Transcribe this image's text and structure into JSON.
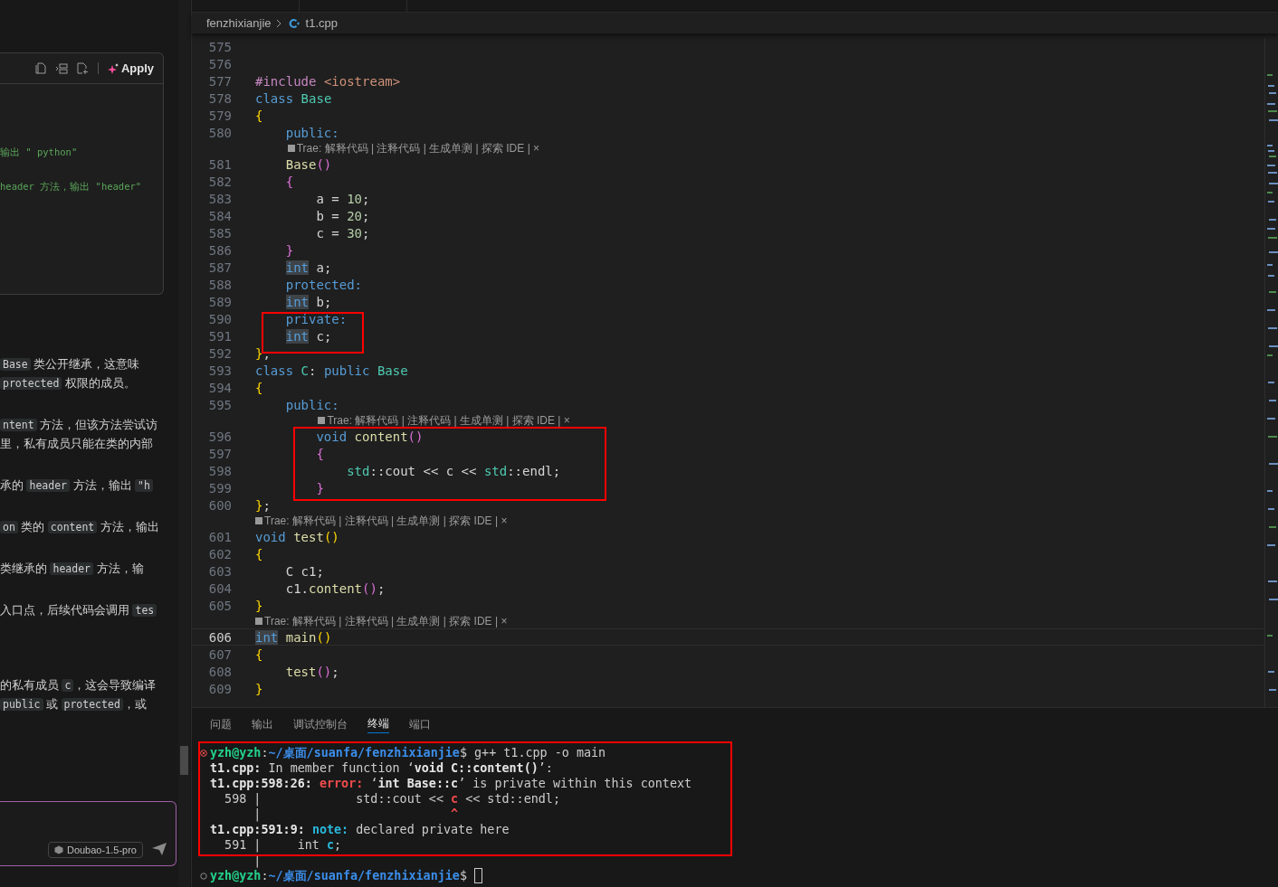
{
  "chat": {
    "code_card": {
      "action": "Apply",
      "lines": [
        "输出 \" python\"",
        "header 方法，输出 \"header\""
      ]
    },
    "sections": [
      [
        [
          [
            {
              "text": "Base",
              "kind": "code"
            },
            {
              "text": " 类公开继承，这意味",
              "kind": "prose"
            }
          ],
          [
            {
              "text": "protected",
              "kind": "code"
            },
            {
              "text": " 权限的成员。",
              "kind": "prose"
            }
          ]
        ],
        [
          [
            {
              "text": "ntent",
              "kind": "code"
            },
            {
              "text": " 方法，但该方法尝试访",
              "kind": "prose"
            }
          ],
          [
            {
              "text": " 里，私有成员只能在类的内部",
              "kind": "prose"
            }
          ]
        ],
        [
          [
            {
              "text": "承的 ",
              "kind": "prose"
            },
            {
              "text": "header",
              "kind": "code"
            },
            {
              "text": " 方法，输出 ",
              "kind": "prose"
            },
            {
              "text": "\"h",
              "kind": "code"
            }
          ]
        ],
        [
          [
            {
              "text": "on",
              "kind": "code"
            },
            {
              "text": " 类的 ",
              "kind": "prose"
            },
            {
              "text": "content",
              "kind": "code"
            },
            {
              "text": " 方法，输出",
              "kind": "prose"
            }
          ]
        ],
        [
          [
            {
              "text": " 类继承的 ",
              "kind": "prose"
            },
            {
              "text": "header",
              "kind": "code"
            },
            {
              "text": " 方法，输",
              "kind": "prose"
            }
          ]
        ],
        [
          [
            {
              "text": "入口点，后续代码会调用 ",
              "kind": "prose"
            },
            {
              "text": "tes",
              "kind": "code"
            }
          ]
        ]
      ],
      [
        [
          [
            {
              "text": "的私有成员 ",
              "kind": "prose"
            },
            {
              "text": "c",
              "kind": "code"
            },
            {
              "text": "，这会导致编译",
              "kind": "prose"
            }
          ],
          [
            {
              "text": "public",
              "kind": "code"
            },
            {
              "text": " 或 ",
              "kind": "prose"
            },
            {
              "text": "protected",
              "kind": "code"
            },
            {
              "text": "，或",
              "kind": "prose"
            }
          ]
        ]
      ]
    ],
    "input": {
      "model": "Doubao-1.5-pro"
    }
  },
  "editor": {
    "breadcrumb": [
      "fenzhixianjie",
      "t1.cpp"
    ],
    "lines": [
      {
        "n": "575",
        "current": false
      },
      {
        "n": "576",
        "current": false
      },
      {
        "n": "577",
        "current": false,
        "tokens": [
          {
            "text": "#include",
            "kind": "pre"
          },
          {
            "text": " <iostream>",
            "kind": "str"
          }
        ]
      },
      {
        "n": "578",
        "current": false,
        "tokens": [
          {
            "text": "class",
            "kind": "kw"
          },
          {
            "text": " Base",
            "kind": "type"
          }
        ]
      },
      {
        "n": "579",
        "current": false,
        "tokens": [
          {
            "text": "{",
            "kind": "b1"
          }
        ]
      },
      {
        "n": "580",
        "current": false,
        "tokens": [
          {
            "text": "    public:",
            "kind": "kw"
          }
        ]
      },
      {
        "n": "581",
        "current": false,
        "lens": "Trae: 解释代码 | 注释代码 | 生成单测 | 探索 IDE | ×",
        "tokens": [
          {
            "text": "    Base",
            "kind": "fn"
          },
          {
            "text": "()",
            "kind": "b2"
          }
        ]
      },
      {
        "n": "582",
        "current": false,
        "tokens": [
          {
            "text": "    {",
            "kind": "b2"
          }
        ]
      },
      {
        "n": "583",
        "current": false,
        "tokens": [
          {
            "text": "        a = ",
            "kind": "plain"
          },
          {
            "text": "10",
            "kind": "num"
          },
          {
            "text": ";",
            "kind": "plain"
          }
        ]
      },
      {
        "n": "584",
        "current": false,
        "tokens": [
          {
            "text": "        b = ",
            "kind": "plain"
          },
          {
            "text": "20",
            "kind": "num"
          },
          {
            "text": ";",
            "kind": "plain"
          }
        ]
      },
      {
        "n": "585",
        "current": false,
        "tokens": [
          {
            "text": "        c = ",
            "kind": "plain"
          },
          {
            "text": "30",
            "kind": "num"
          },
          {
            "text": ";",
            "kind": "plain"
          }
        ]
      },
      {
        "n": "586",
        "current": false,
        "tokens": [
          {
            "text": "    }",
            "kind": "b2"
          }
        ]
      },
      {
        "n": "587",
        "current": false,
        "tokens": [
          {
            "text": "    int",
            "kind": "match"
          },
          {
            "text": " a;",
            "kind": "plain"
          }
        ]
      },
      {
        "n": "588",
        "current": false,
        "tokens": [
          {
            "text": "    protected:",
            "kind": "kw"
          }
        ]
      },
      {
        "n": "589",
        "current": false,
        "tokens": [
          {
            "text": "    int",
            "kind": "match"
          },
          {
            "text": " b;",
            "kind": "plain"
          }
        ]
      },
      {
        "n": "590",
        "current": false,
        "tokens": [
          {
            "text": "    private:",
            "kind": "kw"
          }
        ]
      },
      {
        "n": "591",
        "current": false,
        "tokens": [
          {
            "text": "    int",
            "kind": "match"
          },
          {
            "text": " c;",
            "kind": "plain"
          }
        ]
      },
      {
        "n": "592",
        "current": false,
        "tokens": [
          {
            "text": "}",
            "kind": "b1"
          },
          {
            "text": ";",
            "kind": "plain"
          }
        ]
      },
      {
        "n": "593",
        "current": false,
        "tokens": [
          {
            "text": "class",
            "kind": "kw"
          },
          {
            "text": " C",
            "kind": "type"
          },
          {
            "text": ": ",
            "kind": "plain"
          },
          {
            "text": "public",
            "kind": "kw"
          },
          {
            "text": " Base",
            "kind": "type"
          }
        ]
      },
      {
        "n": "594",
        "current": false,
        "tokens": [
          {
            "text": "{",
            "kind": "b1"
          }
        ]
      },
      {
        "n": "595",
        "current": false,
        "tokens": [
          {
            "text": "    public:",
            "kind": "kw"
          }
        ]
      },
      {
        "n": "596",
        "current": false,
        "lens": "Trae: 解释代码 | 注释代码 | 生成单测 | 探索 IDE | ×",
        "tokens": [
          {
            "text": "        void",
            "kind": "kw"
          },
          {
            "text": " content",
            "kind": "fn"
          },
          {
            "text": "()",
            "kind": "b2"
          }
        ]
      },
      {
        "n": "597",
        "current": false,
        "tokens": [
          {
            "text": "        {",
            "kind": "b2"
          }
        ]
      },
      {
        "n": "598",
        "current": false,
        "tokens": [
          {
            "text": "            std",
            "kind": "type"
          },
          {
            "text": "::cout << c << ",
            "kind": "plain"
          },
          {
            "text": "std",
            "kind": "type"
          },
          {
            "text": "::endl;",
            "kind": "plain"
          }
        ]
      },
      {
        "n": "599",
        "current": false,
        "tokens": [
          {
            "text": "        }",
            "kind": "b2"
          }
        ]
      },
      {
        "n": "600",
        "current": false,
        "tokens": [
          {
            "text": "}",
            "kind": "b1"
          },
          {
            "text": ";",
            "kind": "plain"
          }
        ]
      },
      {
        "n": "601",
        "current": false,
        "lens": "Trae: 解释代码 | 注释代码 | 生成单测 | 探索 IDE | ×",
        "tokens": [
          {
            "text": "void",
            "kind": "kw"
          },
          {
            "text": " test",
            "kind": "fn"
          },
          {
            "text": "()",
            "kind": "b1"
          }
        ]
      },
      {
        "n": "602",
        "current": false,
        "tokens": [
          {
            "text": "{",
            "kind": "b1"
          }
        ]
      },
      {
        "n": "603",
        "current": false,
        "tokens": [
          {
            "text": "    C c1;",
            "kind": "plain"
          }
        ]
      },
      {
        "n": "604",
        "current": false,
        "tokens": [
          {
            "text": "    c1.",
            "kind": "plain"
          },
          {
            "text": "content",
            "kind": "fn"
          },
          {
            "text": "()",
            "kind": "b2"
          },
          {
            "text": ";",
            "kind": "plain"
          }
        ]
      },
      {
        "n": "605",
        "current": false,
        "tokens": [
          {
            "text": "}",
            "kind": "b1"
          }
        ]
      },
      {
        "n": "606",
        "current": true,
        "lens": "Trae: 解释代码 | 注释代码 | 生成单测 | 探索 IDE | ×",
        "tokens": [
          {
            "text": "int",
            "kind": "match"
          },
          {
            "text": " main",
            "kind": "fn"
          },
          {
            "text": "()",
            "kind": "b1"
          }
        ]
      },
      {
        "n": "607",
        "current": false,
        "tokens": [
          {
            "text": "{",
            "kind": "b1"
          }
        ]
      },
      {
        "n": "608",
        "current": false,
        "tokens": [
          {
            "text": "    test",
            "kind": "fn"
          },
          {
            "text": "()",
            "kind": "b2"
          },
          {
            "text": ";",
            "kind": "plain"
          }
        ]
      },
      {
        "n": "609",
        "current": false,
        "tokens": [
          {
            "text": "}",
            "kind": "b1"
          }
        ]
      }
    ]
  },
  "panel": {
    "tabs": [
      {
        "label": "问题",
        "selected": false
      },
      {
        "label": "输出",
        "selected": false
      },
      {
        "label": "调试控制台",
        "selected": false
      },
      {
        "label": "终端",
        "selected": true
      },
      {
        "label": "端口",
        "selected": false
      }
    ],
    "terminal": [
      {
        "kind": "error",
        "cursor": false,
        "segments": [
          {
            "text": "yzh@yzh",
            "kind": "user"
          },
          {
            "text": ":",
            "kind": "plain"
          },
          {
            "text": "~/桌面/suanfa/fenzhixianjie",
            "kind": "path"
          },
          {
            "text": "$ g++ t1.cpp -o main",
            "kind": "plain"
          }
        ]
      },
      {
        "kind": "output",
        "cursor": false,
        "segments": [
          {
            "text": "t1.cpp:",
            "kind": "bold"
          },
          {
            "text": " In member function ‘",
            "kind": "plain"
          },
          {
            "text": "void C::content()",
            "kind": "bold"
          },
          {
            "text": "’:",
            "kind": "plain"
          }
        ]
      },
      {
        "kind": "output",
        "cursor": false,
        "segments": [
          {
            "text": "t1.cpp:598:26: ",
            "kind": "bold"
          },
          {
            "text": "error: ",
            "kind": "error"
          },
          {
            "text": "‘",
            "kind": "plain"
          },
          {
            "text": "int Base::c",
            "kind": "bold"
          },
          {
            "text": "’ is private within this context",
            "kind": "plain"
          }
        ]
      },
      {
        "kind": "output",
        "cursor": false,
        "segments": [
          {
            "text": "  598 |             std::cout << ",
            "kind": "plain"
          },
          {
            "text": "c",
            "kind": "mark-red"
          },
          {
            "text": " << std::endl;",
            "kind": "plain"
          }
        ]
      },
      {
        "kind": "output",
        "cursor": false,
        "segments": [
          {
            "text": "      |                          ",
            "kind": "plain"
          },
          {
            "text": "^",
            "kind": "mark-red"
          }
        ]
      },
      {
        "kind": "output",
        "cursor": false,
        "segments": [
          {
            "text": "t1.cpp:591:9: ",
            "kind": "bold"
          },
          {
            "text": "note: ",
            "kind": "note"
          },
          {
            "text": "declared private here",
            "kind": "plain"
          }
        ]
      },
      {
        "kind": "output",
        "cursor": false,
        "segments": [
          {
            "text": "  591 |     int ",
            "kind": "plain"
          },
          {
            "text": "c",
            "kind": "mark-cyan"
          },
          {
            "text": ";",
            "kind": "plain"
          }
        ]
      },
      {
        "kind": "output",
        "cursor": false,
        "segments": [
          {
            "text": "      |",
            "kind": "plain"
          }
        ]
      },
      {
        "kind": "idle",
        "cursor": true,
        "segments": [
          {
            "text": "yzh@yzh",
            "kind": "user"
          },
          {
            "text": ":",
            "kind": "plain"
          },
          {
            "text": "~/桌面/suanfa/fenzhixianjie",
            "kind": "path"
          },
          {
            "text": "$ ",
            "kind": "plain"
          }
        ]
      }
    ]
  },
  "annotations": [
    {
      "kind": "rectangle"
    },
    {
      "kind": "rectangle"
    },
    {
      "kind": "rectangle"
    }
  ]
}
